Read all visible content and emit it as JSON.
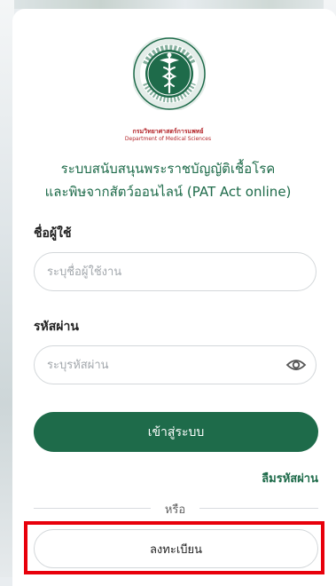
{
  "logo": {
    "ring_text": "กระทรวงสาธารณสุข MINISTRY OF PUBLIC HEALTH",
    "org_name_th": "กรมวิทยาศาสตร์การแพทย์",
    "org_name_en": "Department of Medical Sciences",
    "icon": "caduceus-seal-icon"
  },
  "title": {
    "line1": "ระบบสนับสนุนพระราชบัญญัติเชื้อโรค",
    "line2": "และพิษจากสัตว์ออนไลน์ (PAT Act online)"
  },
  "form": {
    "username_label": "ชื่อผู้ใช้",
    "username_placeholder": "ระบุชื่อผู้ใช้งาน",
    "password_label": "รหัสผ่าน",
    "password_placeholder": "ระบุรหัสผ่าน",
    "show_password_icon": "eye-icon",
    "login_label": "เข้าสู่ระบบ",
    "forgot_label": "ลืมรหัสผ่าน",
    "or_label": "หรือ",
    "register_label": "ลงทะเบียน"
  },
  "colors": {
    "primary": "#1e6b4a",
    "seal_red": "#b4252a",
    "highlight": "#e8000b"
  }
}
